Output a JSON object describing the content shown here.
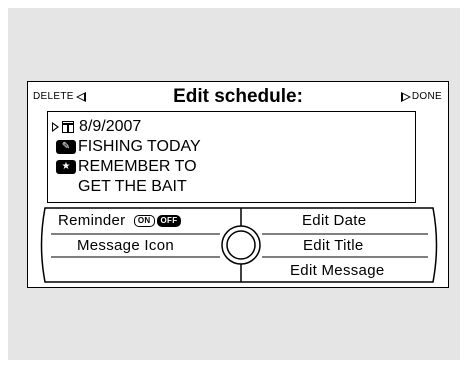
{
  "header": {
    "delete_label": "DELETE",
    "title": "Edit schedule:",
    "done_label": "DONE"
  },
  "entry": {
    "date": "8/9/2007",
    "title": "FISHING TODAY",
    "message_line1": "REMEMBER TO",
    "message_line2": "GET THE BAIT"
  },
  "controls": {
    "reminder_label": "Reminder",
    "reminder_on": "ON",
    "reminder_off": "OFF",
    "message_icon_label": "Message Icon",
    "edit_date_label": "Edit Date",
    "edit_title_label": "Edit Title",
    "edit_message_label": "Edit Message"
  },
  "icons": [
    "calendar-icon",
    "message-icon",
    "cursor-icon",
    "delete-arrow-icon",
    "done-arrow-icon",
    "selector-knob-icon"
  ]
}
